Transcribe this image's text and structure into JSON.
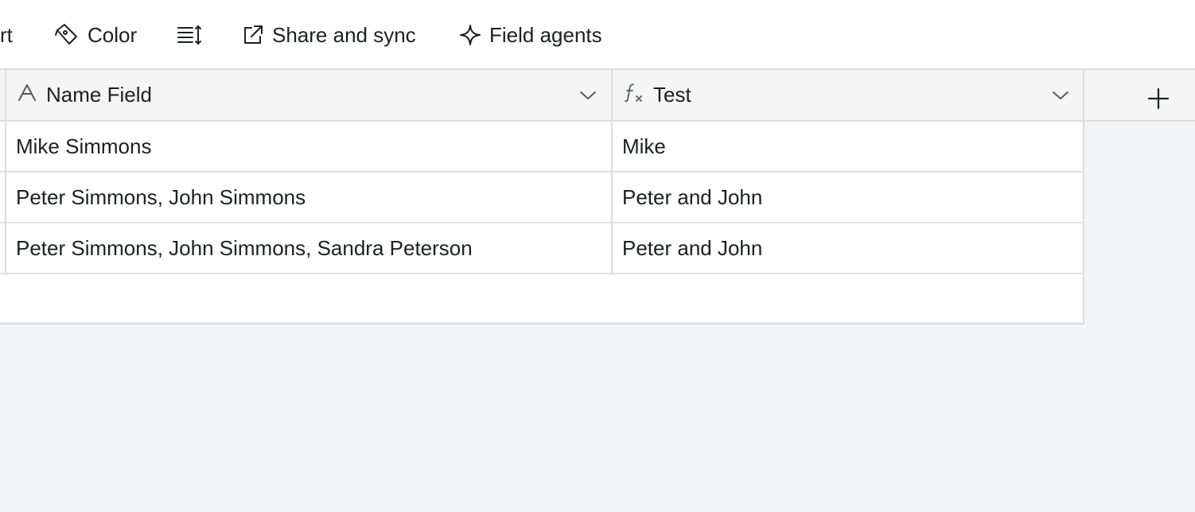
{
  "toolbar": {
    "cut_label": "rt",
    "color_label": "Color",
    "row_height_icon": "row-height-icon",
    "share_label": "Share and sync",
    "agents_label": "Field agents"
  },
  "table": {
    "columns": [
      {
        "label": "Name Field",
        "icon": "text-field-icon"
      },
      {
        "label": "Test",
        "icon": "formula-icon"
      }
    ],
    "rows": [
      {
        "name": "Mike Simmons",
        "test": "Mike"
      },
      {
        "name": "Peter Simmons, John Simmons",
        "test": "Peter and John"
      },
      {
        "name": "Peter Simmons, John Simmons, Sandra Peterson",
        "test": "Peter and John"
      }
    ]
  },
  "colors": {
    "background": "#f3f4f8",
    "header": "#f5f5f5",
    "border": "#dadce0",
    "text": "#1d1f25"
  }
}
